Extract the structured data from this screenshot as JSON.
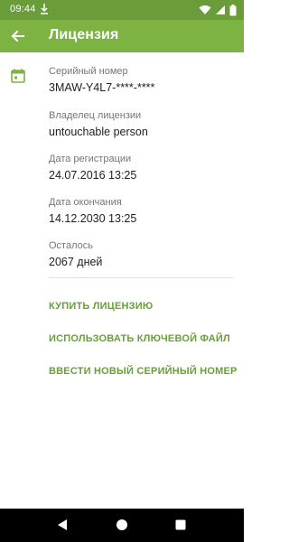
{
  "status_bar": {
    "time": "09:44",
    "icons": [
      "download-icon",
      "wifi-icon",
      "signal-icon",
      "battery-icon"
    ]
  },
  "app_bar": {
    "title": "Лицензия",
    "back_icon": "arrow-left-icon"
  },
  "license": {
    "icon": "calendar-icon",
    "fields": [
      {
        "label": "Серийный номер",
        "value": "3MAW-Y4L7-****-****"
      },
      {
        "label": "Владелец лицензии",
        "value": "untouchable person"
      },
      {
        "label": "Дата регистрации",
        "value": "24.07.2016 13:25"
      },
      {
        "label": "Дата окончания",
        "value": "14.12.2030 13:25"
      },
      {
        "label": "Осталось",
        "value": "2067 дней"
      }
    ]
  },
  "actions": {
    "buy": "КУПИТЬ ЛИЦЕНЗИЮ",
    "key_file": "ИСПОЛЬЗОВАТЬ КЛЮЧЕВОЙ ФАЙЛ",
    "new_serial": "ВВЕСТИ НОВЫЙ СЕРИЙНЫЙ НОМЕР"
  },
  "nav_bar": {
    "icons": [
      "nav-back-icon",
      "nav-home-icon",
      "nav-recents-icon"
    ]
  },
  "colors": {
    "status_bar": "#6a9d3a",
    "app_bar": "#7cb342",
    "accent_text": "#689f38",
    "nav_bar": "#000000"
  }
}
